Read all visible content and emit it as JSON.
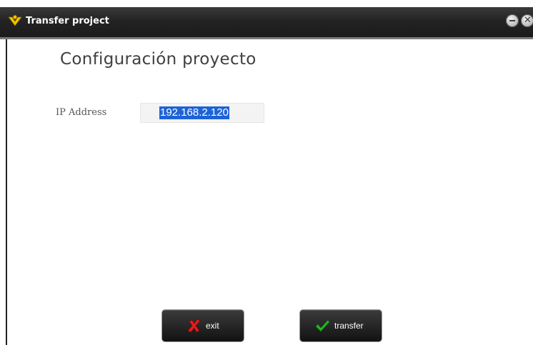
{
  "window": {
    "title": "Transfer project"
  },
  "form": {
    "heading": "Configuración proyecto",
    "ip_label": "IP Address",
    "ip_value": "192.168.2.120"
  },
  "buttons": {
    "exit_label": "exit",
    "transfer_label": "transfer"
  },
  "icons": {
    "app": "app-logo-icon",
    "minimize": "minimize-icon",
    "close": "close-icon",
    "exit": "red-x-icon",
    "transfer": "green-check-icon"
  },
  "colors": {
    "titlebar": "#1b1b1b",
    "selection": "#1e63d6",
    "exit_icon": "#e02020",
    "transfer_icon": "#2bb52b"
  }
}
